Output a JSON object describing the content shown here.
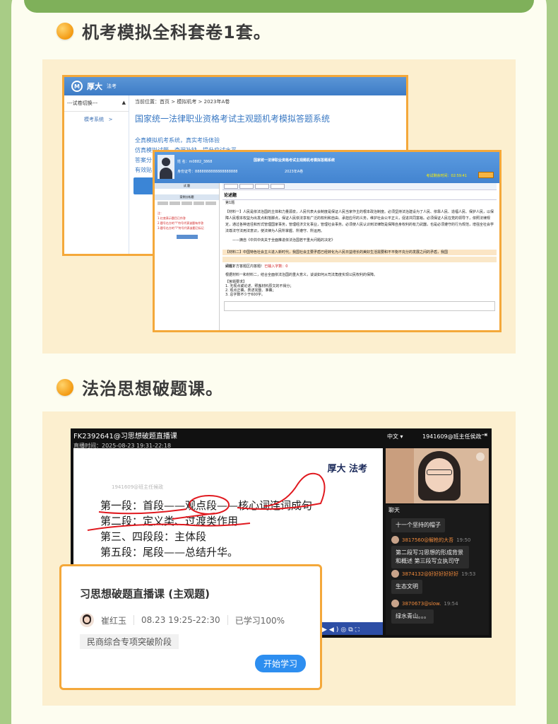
{
  "sections": [
    {
      "title": "机考模拟全科套卷1套。"
    },
    {
      "title": "法治思想破题课。"
    }
  ],
  "exam_system": {
    "brand": "厚大",
    "brand_sub": "法考",
    "switch_label": "---试卷切换---",
    "side_item": "模考系统",
    "breadcrumb": "当前位置：首页 > 模拟机考 > 2023年A卷",
    "title": "国家统一法律职业资格考试主观题机考模拟答题系统",
    "lines": [
      "全真模拟机考系统，真实考场体验",
      "仿真模拟试题，查漏补缺，提升应试水平",
      "答案分",
      "有效贴"
    ],
    "inner": {
      "header": "国家统一法律职业资格考试主观题机考模拟答题系统",
      "name": "姓 名：",
      "name_value": "m0882_3868",
      "id_label": "身份证号：",
      "id_value": "8888888888888888888",
      "paper": "2023年A卷",
      "timer_label": "考试剩余时间：",
      "timer_value": "02:59:41",
      "left_head": "试 题",
      "left_head2": "案例分析题",
      "left_notes": [
        "注：",
        "1.红底表示题目已作答",
        "2.题号右方的\"!\"符号代表该题有作答",
        "3.题号右方的\"?\"符号代表该题已标记"
      ],
      "tab_main": "试 题",
      "q_section": "论述题",
      "q_sub": "第1题",
      "para1": "【材料一】人民是依法治国的主体和力量源泉，人民代表大会制度是保证人民当家作主的根本政治制度。必须坚持法治建设为了人民、依靠人民、造福人民、保护人民，以保障人民根本权益为出发点和落脚点，保证人民依法享有广泛的权利和自由、承担应尽的义务，维护社会公平正义，促进共同富裕。必须保证人民在党的领导下，依照法律规定，通过各种途径和形式管理国家事务，管理经济文化事业，管理社会事务。必须使人民认识到法律既是保障自身权利的有力武器，也是必须遵守的行为规范，增强全社会学法尊法守法用法意识，使法律为人民所掌握、所遵守、所运用。",
      "source": "——摘自《中共中央关于全面推进依法治国若干重大问题的决定》",
      "para2": "【材料二】中国特色社会主义进入新时代，我国社会主要矛盾已经转化为人民日益增长的美好生活需要和不平衡不充分的发展之间的矛盾，我国",
      "q_bar": "问题1",
      "answer_prompt": "请在下方答题区内答题!",
      "answered_count": "已输入字数：0",
      "question": "根据材料一和材料二，结合全面依法治国的重大意义，谈谈如何从司法角度实现公民权利的保障。",
      "requirements": [
        "【答题要求】",
        "1. 无观点或论述、照搬材料原文的不得分；",
        "2. 观点正确，表述完整、准确；",
        "3. 总字数不少于600字。"
      ]
    }
  },
  "live_class": {
    "title": "FK2392641@习思想破题直播课",
    "time": "直播时间：2025-08-23 19:31-22:18",
    "lang": "中文",
    "user": "1941609@班主任侯政",
    "watermark": "1941609@班主任候政",
    "logo": "厚大 法考",
    "slide_lines": [
      "第一段：首段——观点段——核心词连词成句",
      "第二段：定义类、过渡类作用",
      "第三、四段段：主体段",
      "第五段：尾段——总结升华。"
    ],
    "chat_header": "聊天",
    "messages": [
      {
        "user": "",
        "time": "",
        "text": "十一个坚持的帽子"
      },
      {
        "user": "3817560@解枪的大吾",
        "time": "19:50",
        "text": "第二段写习思想的形成背景和概述 第三段写立执司守"
      },
      {
        "user": "3874132@好好好好好好",
        "time": "19:53",
        "text": "生态文明"
      },
      {
        "user": "3870673@slow.",
        "time": "19:54",
        "text": "绿水青山。。。"
      }
    ]
  },
  "course_card": {
    "title": "习思想破题直播课 (主观题)",
    "teacher": "崔红玉",
    "time": "08.23 19:25-22:30",
    "progress": "已学习100%",
    "tag": "民商综合专项突破阶段",
    "button": "开始学习"
  },
  "colors": {
    "accent": "#f4a83a",
    "button": "#2d8ef0",
    "bg_green": "#a8cc86"
  }
}
